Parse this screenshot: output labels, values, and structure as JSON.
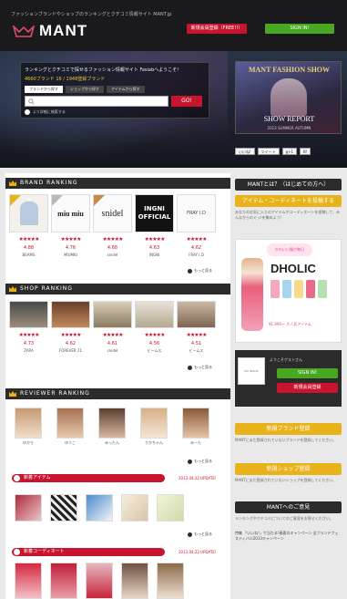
{
  "header": {
    "tagline": "ファッションブランドやショップのランキングとクチコミ情報サイト MANT.jp",
    "logo_text": "MANT",
    "register_label": "新規会員登録（FREE!!）",
    "signin_label": "SIGN IN!"
  },
  "search": {
    "intro": "ランキングとクチコミで探せるファッション情報サイト Fasiabへようこそ!",
    "count": "4660ブランド 16 / 1948登録ブランド",
    "tabs": [
      "ブランドから探す",
      "ショップから探す",
      "アイテムから探す"
    ],
    "placeholder": "",
    "go_label": "GO!",
    "detail_label": "より詳細に検索する"
  },
  "fashion_show": {
    "title": "MANT FASHION SHOW",
    "report": "SHOW REPORT",
    "sub": "2013 SUMMER AUTUMN"
  },
  "social": [
    "いいね!",
    "ツイート",
    "g+1",
    "B!"
  ],
  "brand_ranking": {
    "title": "BRAND RANKING",
    "items": [
      {
        "name": "BEAMS",
        "rating": "4.88",
        "stars": "★★★★★",
        "logo": ""
      },
      {
        "name": "MIUMIU",
        "rating": "4.76",
        "stars": "★★★★★",
        "logo": "miu miu"
      },
      {
        "name": "snidel",
        "rating": "4.68",
        "stars": "★★★★★",
        "logo": "snidel"
      },
      {
        "name": "INGNI",
        "rating": "4.63",
        "stars": "★★★★★",
        "logo": "INGNI OFFICIAL"
      },
      {
        "name": "FRAY I.D",
        "rating": "4.62",
        "stars": "★★★★★",
        "logo": "FRAY I.D"
      }
    ],
    "more_label": "もっと見る"
  },
  "shop_ranking": {
    "title": "SHOP RANKING",
    "items": [
      {
        "name": "ZARA",
        "rating": "4.73",
        "stars": "★★★★★"
      },
      {
        "name": "FOREVER 21",
        "rating": "4.62",
        "stars": "★★★★★"
      },
      {
        "name": "snidel",
        "rating": "4.61",
        "stars": "★★★★★"
      },
      {
        "name": "ビームス",
        "rating": "4.56",
        "stars": "★★★★★"
      },
      {
        "name": "ビームス",
        "rating": "4.51",
        "stars": "★★★★★"
      }
    ],
    "more_label": "もっと見る"
  },
  "reviewer_ranking": {
    "title": "REVIEWER RANKING",
    "items": [
      "ゆかり",
      "ゆうこ",
      "みったん",
      "りかちゃん",
      "みーた"
    ],
    "more_label": "もっと見る"
  },
  "new_items": {
    "title": "新着アイテム",
    "updated": "2013.04.22 UPDATE!",
    "more_label": "もっと見る"
  },
  "new_coordinates": {
    "title": "新着コーディネート",
    "updated": "2013.04.22 UPDATE!"
  },
  "sidebar": {
    "about_label": "MANTとは？（はじめての方へ）",
    "post_label": "アイテム・コーディネートを投稿する",
    "post_desc": "あなたのお気に入りのアイテムやコーディネートを投稿して、みんなからのぐっ!を集めよう!",
    "ad_bubble": "かわいい服が毎日",
    "ad_brand": "DHOLIC",
    "ad_price": "¥1,990〜 大人気アイテム",
    "welcome": "ようこそゲストさん",
    "avatar_text": "NO IMAGE",
    "login_signin": "SIGN IN!",
    "login_register": "新規会員登録",
    "brand_register": "新規ブランド登録",
    "brand_register_desc": "MANTにまだ登録されていないブランドを登録してください。",
    "shop_register": "新規ショップ登録",
    "shop_register_desc": "MANTにまだ登録されていないショップを登録してください。",
    "mant_label": "MANTへのご意見",
    "mant_desc": "ランキングやクチコミについてのご意見をお寄せください。",
    "news": "特集 「いいね!」で当たる!春夏のキャンペーン 全ブランドフェスティバル2013キャンペーン"
  },
  "colors": {
    "accent_red": "#c8142e",
    "accent_green": "#49a821",
    "accent_yellow": "#e8b21a",
    "dark": "#2b2b2b"
  }
}
